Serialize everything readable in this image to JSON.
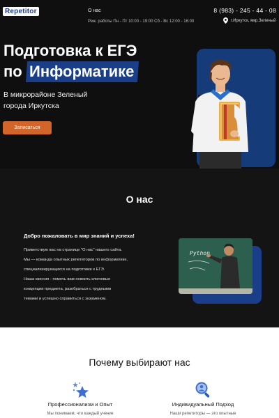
{
  "header": {
    "logo": "Repetitor",
    "nav_about": "О нас",
    "hours": "Реж. работы Пн - Пт 10:00 - 19:00  Сб - Вс 12:00 - 16:00",
    "phone": "8 (983) - 245 - 44 - 08",
    "address": "г.Иркутск, мкр.Зеленый"
  },
  "hero": {
    "title_line1": "Подготовка к ЕГЭ",
    "title_line2_prefix": "по",
    "title_line2_highlight": "Информатике",
    "subtitle": "В микрорайоне Зеленый города Иркутска",
    "cta_label": "Записаться"
  },
  "about": {
    "title": "О нас",
    "welcome": "Добро пожаловать в мир знаний и успеха!",
    "paragraphs": [
      "Приветствую вас на странице \"О нас\" нашего сайта.",
      "Мы — команда опытных репетиторов по информатике,",
      "специализирующихся на подготовке к ЕГЭ.",
      "Наша миссия - помочь вам освоить ключевые",
      "концепции предмета, разобраться с трудными",
      "темами и успешно справиться с экзаменом."
    ],
    "board_text": "Python"
  },
  "why": {
    "title": "Почему выбирают нас",
    "features": [
      {
        "title": "Профессионализм и Опыт",
        "text": "Мы понимаем, что каждый ученик",
        "icon": "stars-icon"
      },
      {
        "title": "Индивидуальный Подход",
        "text": "Наши репетиторы — это опытные",
        "icon": "magnifier-person-icon"
      }
    ]
  },
  "colors": {
    "accent_blue": "#1a3f88",
    "cta_orange": "#d2652a",
    "dark_bg": "#141414"
  }
}
